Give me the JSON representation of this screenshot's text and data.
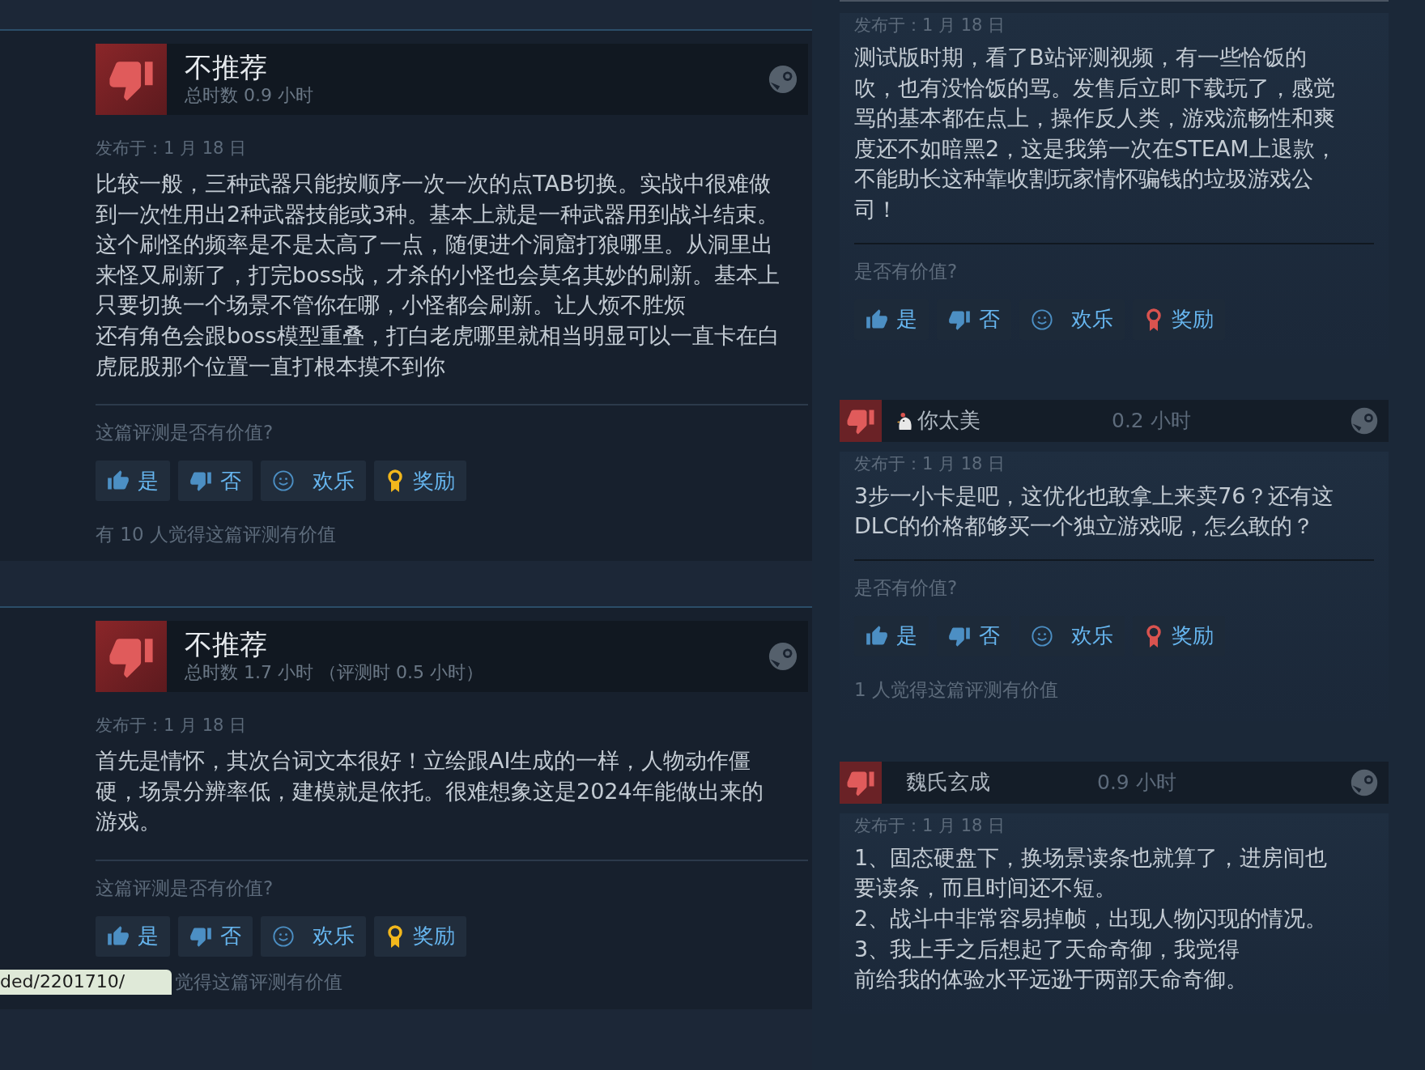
{
  "left_reviews": [
    {
      "verdict": "不推荐",
      "hours": "总时数 0.9 小时",
      "date": "发布于：1 月 18 日",
      "text": [
        "比较一般，三种武器只能按顺序一次一次的点TAB切换。实战中很难做到一次性用出2种武器技能或3种。基本上就是一种武器用到战斗结束。这个刷怪的频率是不是太高了一点，随便进个洞窟打狼哪里。从洞里出来怪又刷新了，打完boss战，才杀的小怪也会莫名其妙的刷新。基本上只要切换一个场景不管你在哪，小怪都会刷新。让人烦不胜烦",
        "还有角色会跟boss模型重叠，打白老虎哪里就相当明显可以一直卡在白虎屁股那个位置一直打根本摸不到你"
      ],
      "question": "这篇评测是否有价值?",
      "buttons": [
        {
          "kind": "yes",
          "label": "是"
        },
        {
          "kind": "no",
          "label": "否"
        },
        {
          "kind": "funny",
          "label": "欢乐"
        },
        {
          "kind": "award",
          "label": "奖励",
          "color": "#f2b71c"
        }
      ],
      "helpful": "有 10 人觉得这篇评测有价值"
    },
    {
      "verdict": "不推荐",
      "hours": "总时数 1.7 小时 （评测时 0.5 小时）",
      "date": "发布于：1 月 18 日",
      "text": [
        "首先是情怀，其次台词文本很好！立绘跟AI生成的一样，人物动作僵硬，场景分辨率低，建模就是依托。很难想象这是2024年能做出来的游戏。"
      ],
      "question": "这篇评测是否有价值?",
      "buttons": [
        {
          "kind": "yes",
          "label": "是"
        },
        {
          "kind": "no",
          "label": "否"
        },
        {
          "kind": "funny",
          "label": "欢乐"
        },
        {
          "kind": "award",
          "label": "奖励",
          "color": "#f2b71c"
        }
      ],
      "helpful": "觉得这篇评测有价值"
    }
  ],
  "status_url": "ded/2201710/",
  "right_reviews": [
    {
      "date": "发布于：1 月 18 日",
      "text": [
        "测试版时期，看了B站评测视频，有一些恰饭的吹，也有没恰饭的骂。发售后立即下载玩了，感觉骂的基本都在点上，操作反人类，游戏流畅性和爽度还不如暗黑2，这是我第一次在STEAM上退款，不能助长这种靠收割玩家情怀骗钱的垃圾游戏公司！"
      ],
      "question": "是否有价值?",
      "buttons": [
        {
          "kind": "yes",
          "label": "是"
        },
        {
          "kind": "no",
          "label": "否"
        },
        {
          "kind": "funny",
          "label": "欢乐"
        },
        {
          "kind": "award",
          "label": "奖励",
          "color": "#d9534f"
        }
      ]
    },
    {
      "user": "你太美",
      "badge": true,
      "hours": "0.2 小时",
      "date": "发布于：1 月 18 日",
      "text": [
        "3步一小卡是吧，这优化也敢拿上来卖76？还有这DLC的价格都够买一个独立游戏呢，怎么敢的？"
      ],
      "question": "是否有价值?",
      "buttons": [
        {
          "kind": "yes",
          "label": "是"
        },
        {
          "kind": "no",
          "label": "否"
        },
        {
          "kind": "funny",
          "label": "欢乐"
        },
        {
          "kind": "award",
          "label": "奖励",
          "color": "#d9534f"
        }
      ],
      "helpful": "1 人觉得这篇评测有价值"
    },
    {
      "user": "魏氏玄成",
      "badge": false,
      "hours": "0.9 小时",
      "date": "发布于：1 月 18 日",
      "text": [
        "1、固态硬盘下，换场景读条也就算了，进房间也要读条，而且时间还不短。",
        "2、战斗中非常容易掉帧，出现人物闪现的情况。",
        "3、我上手之后想起了天命奇御，我觉得",
        "前给我的体验水平远逊于两部天命奇御。"
      ]
    }
  ]
}
